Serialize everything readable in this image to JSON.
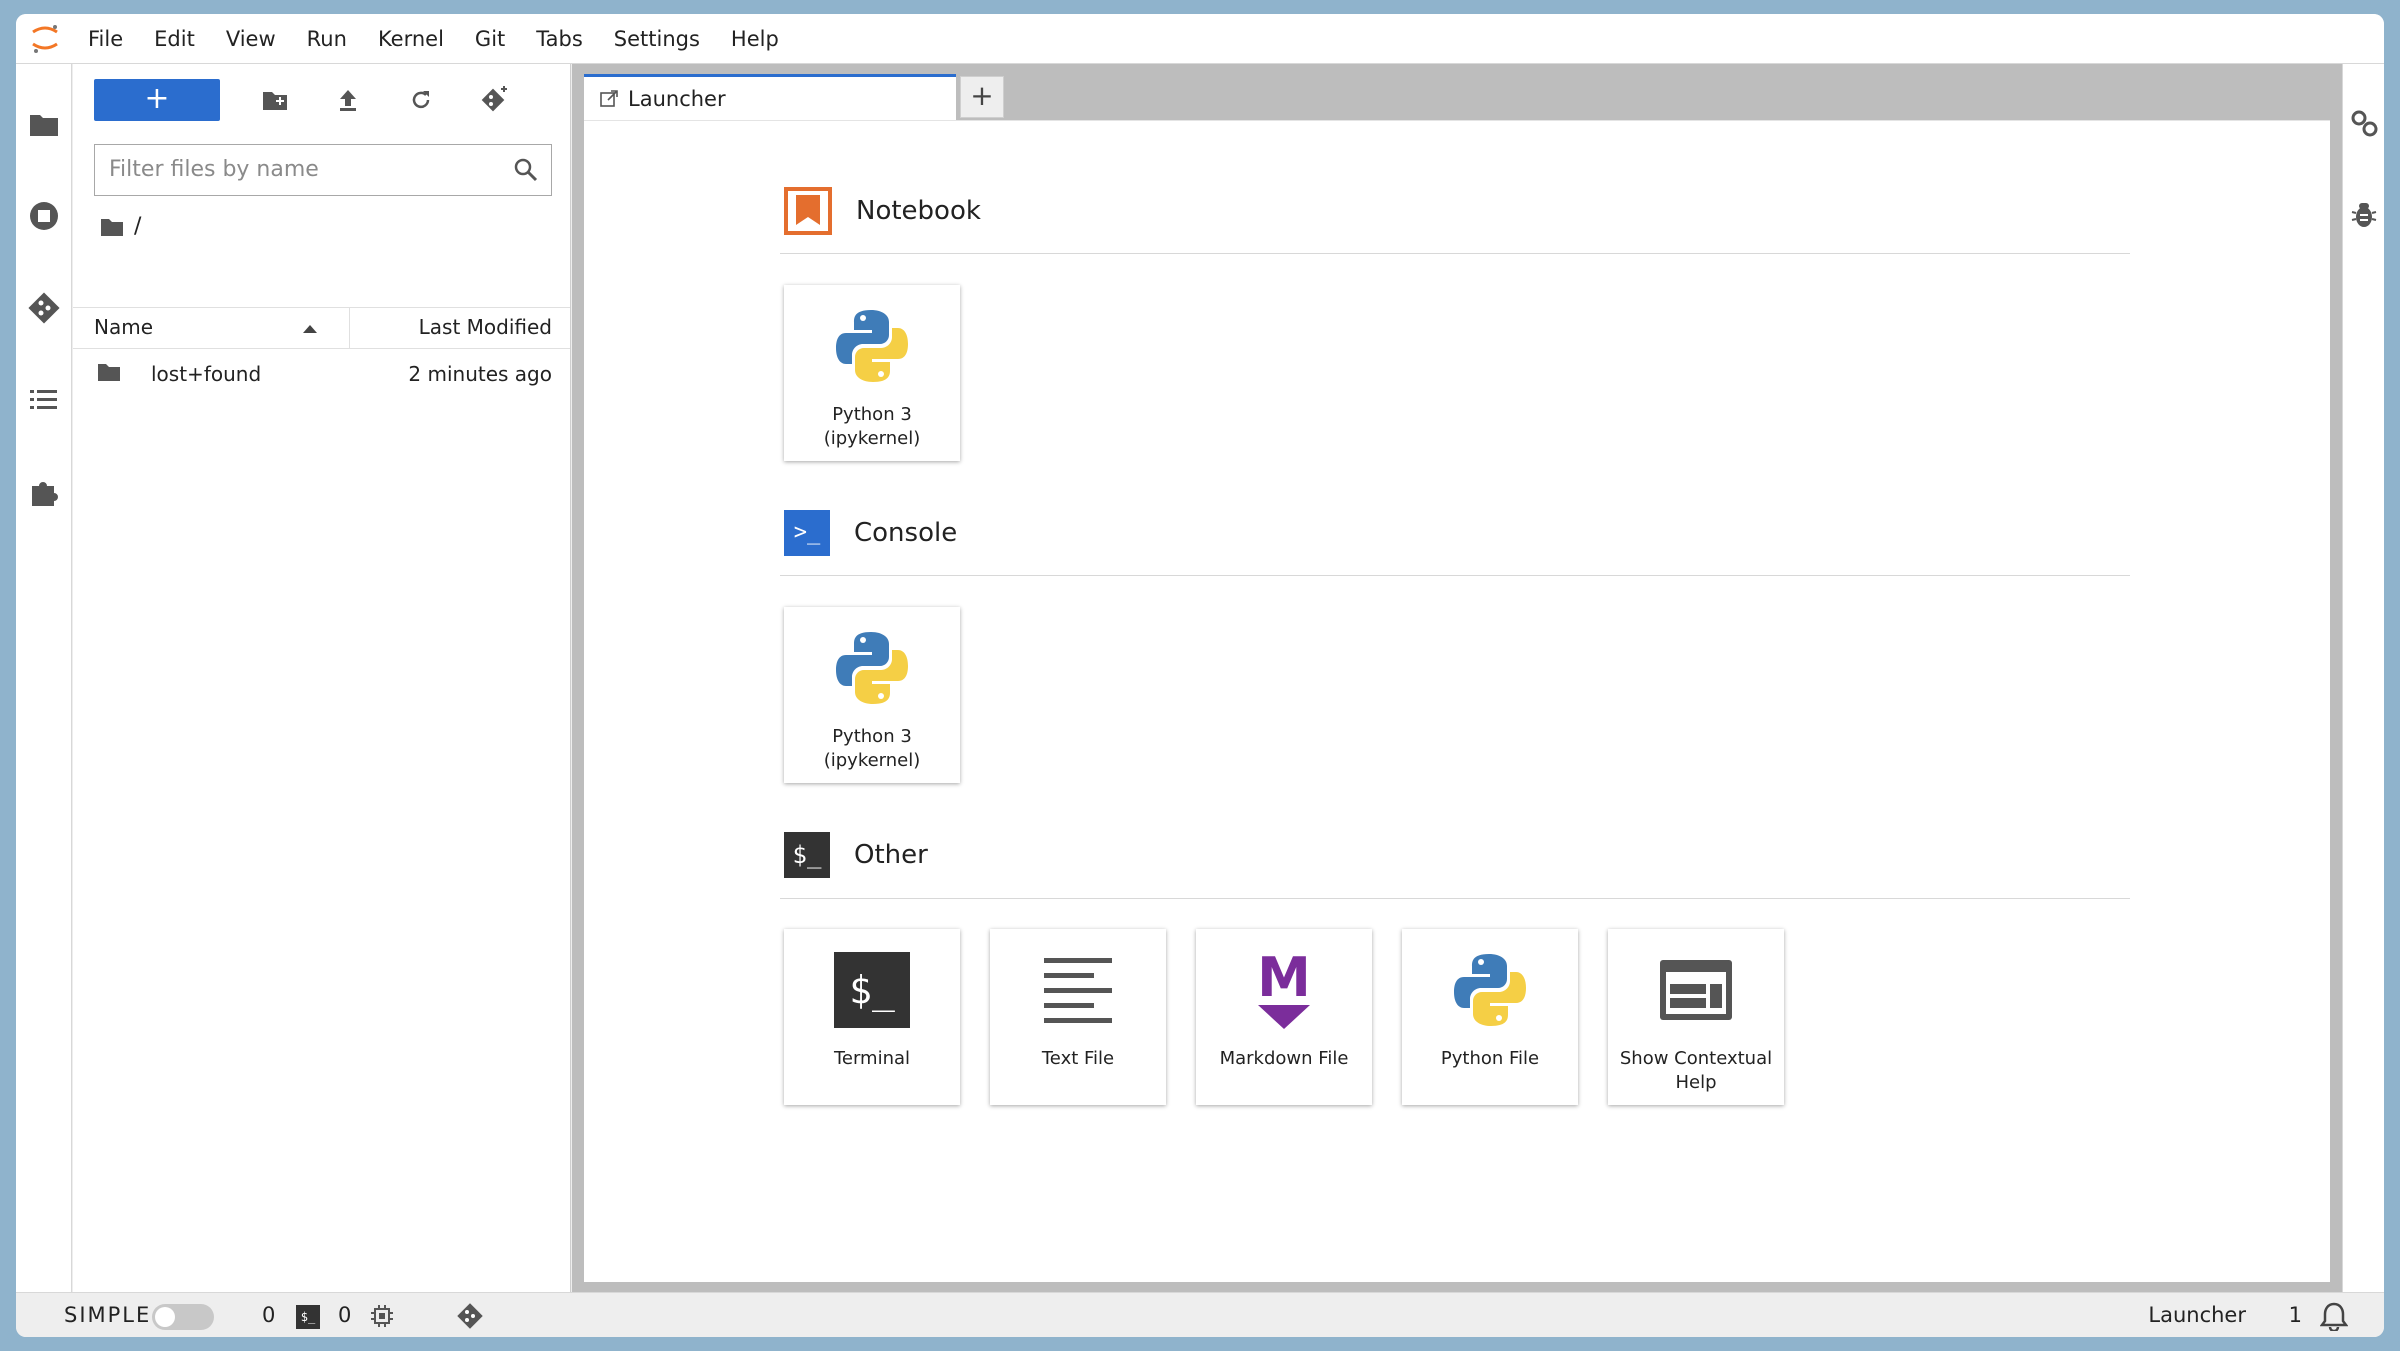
{
  "menubar": {
    "items": [
      "File",
      "Edit",
      "View",
      "Run",
      "Kernel",
      "Git",
      "Tabs",
      "Settings",
      "Help"
    ]
  },
  "left_rail": {
    "icons": [
      "folder-icon",
      "running-icon",
      "git-icon",
      "toc-icon",
      "extension-icon"
    ]
  },
  "filebrowser": {
    "new_label": "+",
    "filter_placeholder": "Filter files by name",
    "breadcrumb": "/",
    "columns": {
      "name": "Name",
      "modified": "Last Modified"
    },
    "rows": [
      {
        "name": "lost+found",
        "modified": "2 minutes ago"
      }
    ]
  },
  "tabs": {
    "active": "Launcher",
    "add_label": "+"
  },
  "launcher": {
    "sections": [
      {
        "title": "Notebook",
        "cards": [
          {
            "label": "Python 3 (ipykernel)"
          }
        ]
      },
      {
        "title": "Console",
        "cards": [
          {
            "label": "Python 3 (ipykernel)"
          }
        ]
      },
      {
        "title": "Other",
        "cards": [
          {
            "label": "Terminal"
          },
          {
            "label": "Text File"
          },
          {
            "label": "Markdown File"
          },
          {
            "label": "Python File"
          },
          {
            "label": "Show Contextual Help"
          }
        ]
      }
    ],
    "console_icon_text": ">_",
    "other_icon_text": "$_",
    "terminal_icon_text": "$_",
    "markdown_icon_text": "M"
  },
  "statusbar": {
    "mode": "SIMPLE",
    "kernels": "0",
    "terminal_icon_text": "$_",
    "terminals": "0",
    "current": "Launcher",
    "notifications": "1"
  },
  "colors": {
    "accent": "#2b6dce",
    "notebook_orange": "#e46e2e",
    "markdown_purple": "#7b2d9b",
    "dark_icon": "#333333"
  }
}
